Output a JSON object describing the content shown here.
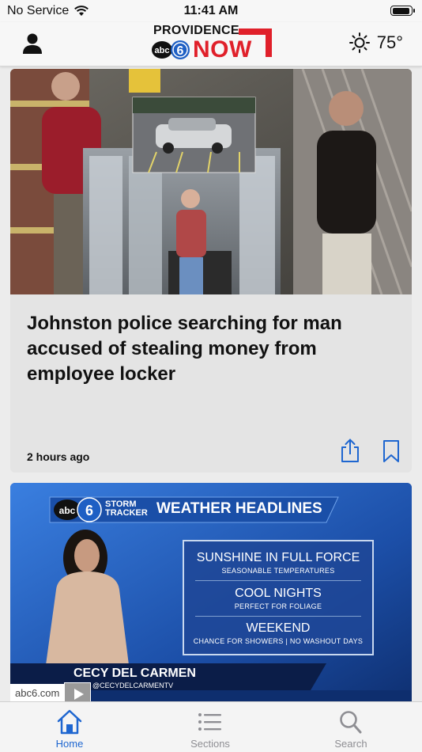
{
  "status_bar": {
    "carrier": "No Service",
    "time": "11:41 AM"
  },
  "header": {
    "logo_top": "PROVIDENCE",
    "logo_badge": "abc6",
    "logo_main": "NOW",
    "temperature": "75°",
    "brand_color": "#e0202a"
  },
  "stories": [
    {
      "headline": "Johnston police searching for man accused of stealing money from employee locker",
      "time_ago": "2 hours ago"
    },
    {
      "graphic": {
        "storm_tracker": "STORM TRACKER",
        "title": "WEATHER HEADLINES",
        "items": [
          {
            "big": "SUNSHINE IN FULL FORCE",
            "small": "SEASONABLE TEMPERATURES"
          },
          {
            "big": "COOL NIGHTS",
            "small": "PERFECT FOR FOLIAGE"
          },
          {
            "big": "WEEKEND",
            "small": "CHANCE FOR  SHOWERS | NO WASHOUT DAYS"
          }
        ],
        "anchor_name": "CECY DEL CARMEN",
        "anchor_handle": "@CECYDELCARMENTV"
      },
      "source": "abc6.com"
    }
  ],
  "tabbar": {
    "tabs": [
      {
        "label": "Home",
        "icon": "home-icon",
        "active": true
      },
      {
        "label": "Sections",
        "icon": "list-icon",
        "active": false
      },
      {
        "label": "Search",
        "icon": "search-icon",
        "active": false
      }
    ],
    "active_color": "#1e66d0",
    "inactive_color": "#8e8e93"
  }
}
